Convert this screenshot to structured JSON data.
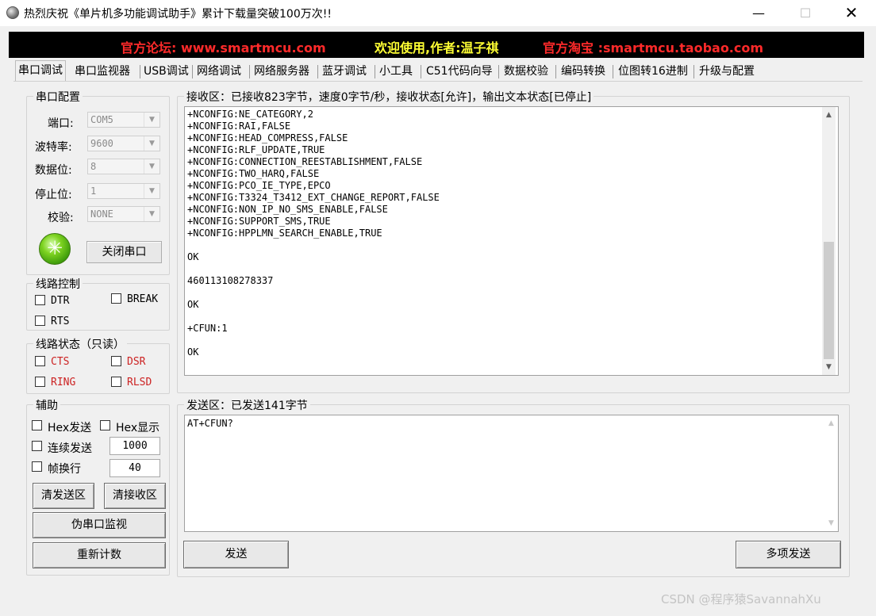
{
  "window": {
    "title": "热烈庆祝《单片机多功能调试助手》累计下载量突破100万次!!",
    "min_label": "—",
    "max_label": "☐",
    "close_label": "✕"
  },
  "banner": {
    "forum": "官方论坛: www.smartmcu.com",
    "welcome": "欢迎使用,作者:温子祺",
    "shop": "官方淘宝 :smartmcu.taobao.com"
  },
  "tabs": [
    "串口调试",
    "串口监视器",
    "USB调试",
    "网络调试",
    "网络服务器",
    "蓝牙调试",
    "小工具",
    "C51代码向导",
    "数据校验",
    "编码转换",
    "位图转16进制",
    "升级与配置"
  ],
  "serial_config": {
    "title": "串口配置",
    "port_label": "端口:",
    "port_value": "COM5",
    "baud_label": "波特率:",
    "baud_value": "9600",
    "databits_label": "数据位:",
    "databits_value": "8",
    "stopbits_label": "停止位:",
    "stopbits_value": "1",
    "parity_label": "校验:",
    "parity_value": "NONE",
    "close_port_button": "关闭串口"
  },
  "line_control": {
    "title": "线路控制",
    "dtr": "DTR",
    "break": "BREAK",
    "rts": "RTS"
  },
  "line_status": {
    "title": "线路状态（只读）",
    "cts": "CTS",
    "dsr": "DSR",
    "ring": "RING",
    "rlsd": "RLSD"
  },
  "aux": {
    "title": "辅助",
    "hex_send": "Hex发送",
    "hex_display": "Hex显示",
    "continuous_send": "连续发送",
    "continuous_interval": "1000",
    "frame_newline": "帧换行",
    "frame_value": "40",
    "clear_send_button": "清发送区",
    "clear_recv_button": "清接收区",
    "pseudo_monitor_button": "伪串口监视",
    "recount_button": "重新计数"
  },
  "receive": {
    "title": "接收区：已接收823字节，速度0字节/秒，接收状态[允许]，输出文本状态[已停止]",
    "lines": [
      "+NCONFIG:NE_CATEGORY,2",
      "+NCONFIG:RAI,FALSE",
      "+NCONFIG:HEAD_COMPRESS,FALSE",
      "+NCONFIG:RLF_UPDATE,TRUE",
      "+NCONFIG:CONNECTION_REESTABLISHMENT,FALSE",
      "+NCONFIG:TWO_HARQ,FALSE",
      "+NCONFIG:PCO_IE_TYPE,EPCO",
      "+NCONFIG:T3324_T3412_EXT_CHANGE_REPORT,FALSE",
      "+NCONFIG:NON_IP_NO_SMS_ENABLE,FALSE",
      "+NCONFIG:SUPPORT_SMS,TRUE",
      "+NCONFIG:HPPLMN_SEARCH_ENABLE,TRUE",
      "",
      "OK",
      "",
      "460113108278337",
      "",
      "OK",
      "",
      "+CFUN:1",
      "",
      "OK"
    ]
  },
  "send": {
    "title": "发送区：已发送141字节",
    "content": "AT+CFUN?",
    "send_button": "发送",
    "multi_send_button": "多项发送"
  },
  "watermark": "CSDN @程序猿SavannahXu"
}
